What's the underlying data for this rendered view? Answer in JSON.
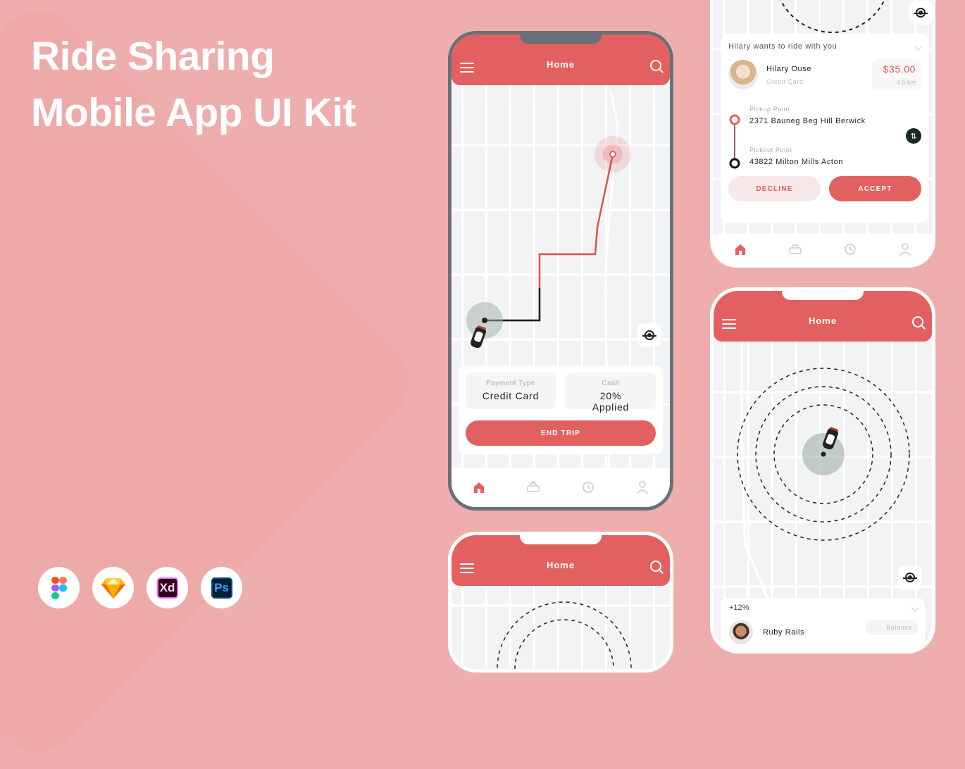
{
  "hero": {
    "title_line1": "Ride Sharing",
    "title_line2": "Mobile App UI Kit"
  },
  "tools": [
    {
      "name": "figma-icon"
    },
    {
      "name": "sketch-icon"
    },
    {
      "name": "xd-icon",
      "label": "Xd"
    },
    {
      "name": "photoshop-icon",
      "label": "Ps"
    }
  ],
  "colors": {
    "accent": "#e26060",
    "background": "#efaeae",
    "frame": "#687079"
  },
  "screen_trip": {
    "header_title": "Home",
    "payment": {
      "label": "Payment Type",
      "value": "Credit Card"
    },
    "cash": {
      "label": "Cash",
      "value": "20% Applied"
    },
    "end_trip_label": "END TRIP",
    "nav": [
      "home",
      "taxi",
      "history",
      "profile"
    ]
  },
  "screen_request": {
    "heading": "Hilary wants to ride with you",
    "rider_name": "Hilary Ouse",
    "rider_payment": "Credit Card",
    "price": "$35.00",
    "distance": "4.5 km",
    "pickup_label": "Pickup Point",
    "pickup_address": "2371 Bauneg Beg Hill Berwick",
    "dropoff_label": "Pickout Point",
    "dropoff_address": "43822 Milton Mills Acton",
    "decline_label": "DECLINE",
    "accept_label": "ACCEPT"
  },
  "screen_search": {
    "header_title": "Home",
    "card_heading": "+12%",
    "rider_name": "Ruby Rails",
    "balance_label": "Balance"
  },
  "screen_bottom": {
    "header_title": "Home"
  }
}
